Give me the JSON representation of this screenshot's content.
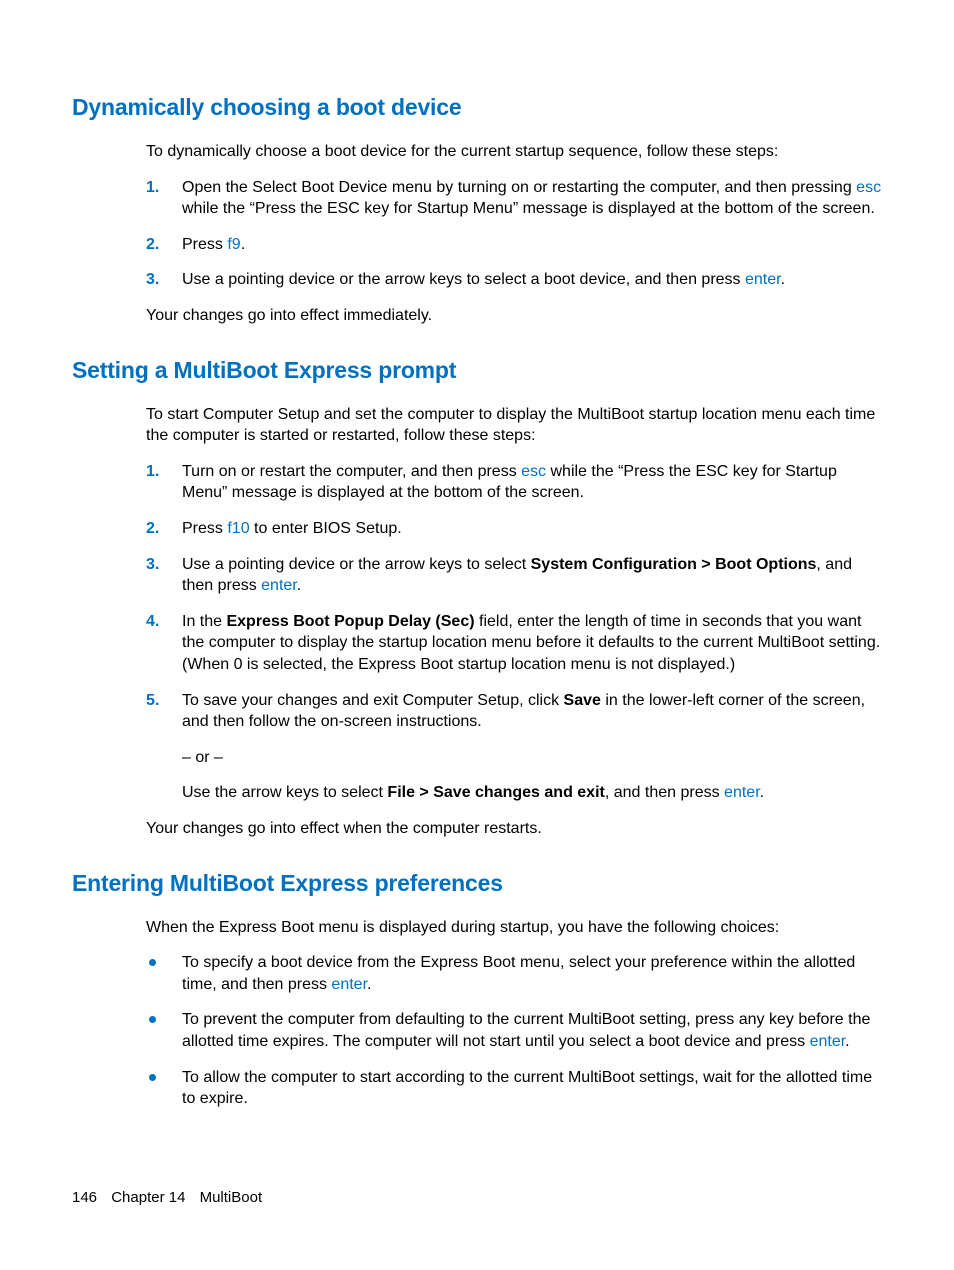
{
  "sections": [
    {
      "heading": "Dynamically choosing a boot device",
      "intro": "To dynamically choose a boot device for the current startup sequence, follow these steps:",
      "steps": [
        {
          "num": "1.",
          "pre": "Open the Select Boot Device menu by turning on or restarting the computer, and then pressing ",
          "key": "esc",
          "post": " while the “Press the ESC key for Startup Menu” message is displayed at the bottom of the screen."
        },
        {
          "num": "2.",
          "pre": "Press ",
          "key": "f9",
          "post": "."
        },
        {
          "num": "3.",
          "pre": "Use a pointing device or the arrow keys to select a boot device, and then press ",
          "key": "enter",
          "post": "."
        }
      ],
      "outro": "Your changes go into effect immediately."
    },
    {
      "heading": "Setting a MultiBoot Express prompt",
      "intro": "To start Computer Setup and set the computer to display the MultiBoot startup location menu each time the computer is started or restarted, follow these steps:",
      "steps": [
        {
          "num": "1.",
          "pre": "Turn on or restart the computer, and then press ",
          "key": "esc",
          "post": " while the “Press the ESC key for Startup Menu” message is displayed at the bottom of the screen."
        },
        {
          "num": "2.",
          "pre": "Press ",
          "key": "f10",
          "post": " to enter BIOS Setup."
        },
        {
          "num": "3.",
          "pre": "Use a pointing device or the arrow keys to select ",
          "bold1": "System Configuration > Boot Options",
          "mid1": ", and then press ",
          "key": "enter",
          "post": "."
        },
        {
          "num": "4.",
          "pre": "In the ",
          "bold1": "Express Boot Popup Delay (Sec)",
          "post": " field, enter the length of time in seconds that you want the computer to display the startup location menu before it defaults to the current MultiBoot setting. (When 0 is selected, the Express Boot startup location menu is not displayed.)"
        },
        {
          "num": "5.",
          "pre": "To save your changes and exit Computer Setup, click ",
          "bold1": "Save",
          "post": " in the lower-left corner of the screen, and then follow the on-screen instructions.",
          "or": "– or –",
          "alt_pre": "Use the arrow keys to select ",
          "alt_bold": "File > Save changes and exit",
          "alt_mid": ", and then press ",
          "alt_key": "enter",
          "alt_post": "."
        }
      ],
      "outro": "Your changes go into effect when the computer restarts."
    },
    {
      "heading": "Entering MultiBoot Express preferences",
      "intro": "When the Express Boot menu is displayed during startup, you have the following choices:",
      "bullets": [
        {
          "pre": "To specify a boot device from the Express Boot menu, select your preference within the allotted time, and then press ",
          "key": "enter",
          "post": "."
        },
        {
          "pre": "To prevent the computer from defaulting to the current MultiBoot setting, press any key before the allotted time expires. The computer will not start until you select a boot device and press ",
          "key": "enter",
          "post": "."
        },
        {
          "pre": "To allow the computer to start according to the current MultiBoot settings, wait for the allotted time to expire."
        }
      ]
    }
  ],
  "footer": {
    "page": "146",
    "chapter": "Chapter 14",
    "title": "MultiBoot"
  }
}
